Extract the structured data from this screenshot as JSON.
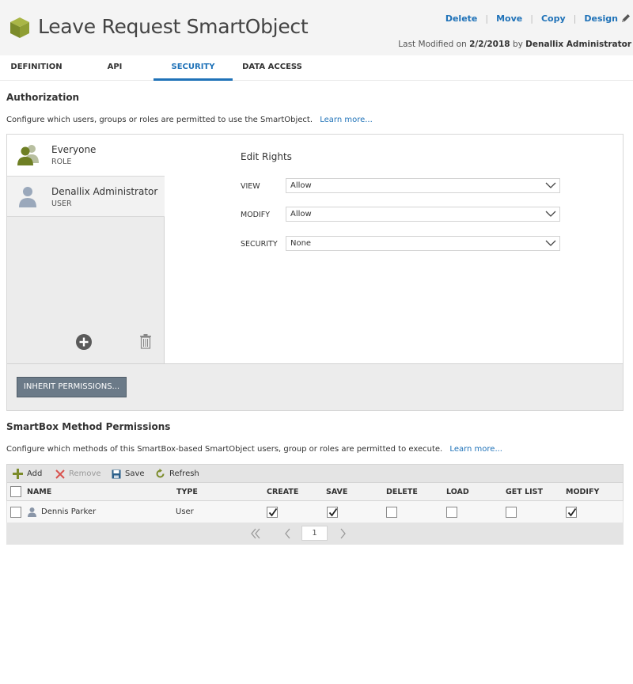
{
  "header": {
    "title": "Leave Request SmartObject",
    "actions": [
      "Delete",
      "Move",
      "Copy",
      "Design"
    ],
    "modified_prefix": "Last Modified on",
    "modified_date": "2/2/2018",
    "modified_by_prefix": "by",
    "modified_by": "Denallix Administrator"
  },
  "tabs": [
    "DEFINITION",
    "API",
    "SECURITY",
    "DATA ACCESS"
  ],
  "active_tab": "SECURITY",
  "authorization": {
    "title": "Authorization",
    "description": "Configure which users, groups or roles are permitted to use the SmartObject.",
    "learn_more": "Learn more...",
    "items": [
      {
        "name": "Everyone",
        "type": "ROLE"
      },
      {
        "name": "Denallix Administrator",
        "type": "USER"
      }
    ],
    "edit_rights_title": "Edit Rights",
    "rights": [
      {
        "label": "VIEW",
        "value": "Allow"
      },
      {
        "label": "MODIFY",
        "value": "Allow"
      },
      {
        "label": "SECURITY",
        "value": "None"
      }
    ],
    "inherit_button": "INHERIT PERMISSIONS..."
  },
  "smartbox": {
    "title": "SmartBox Method Permissions",
    "description": "Configure which methods of this SmartBox-based SmartObject users, group or roles are permitted to execute.",
    "learn_more": "Learn more...",
    "toolbar": {
      "add": "Add",
      "remove": "Remove",
      "save": "Save",
      "refresh": "Refresh"
    },
    "columns": [
      "NAME",
      "TYPE",
      "CREATE",
      "SAVE",
      "DELETE",
      "LOAD",
      "GET LIST",
      "MODIFY"
    ],
    "rows": [
      {
        "name": "Dennis Parker",
        "type": "User",
        "create": true,
        "save": true,
        "delete": false,
        "load": false,
        "get_list": false,
        "modify": true
      }
    ],
    "page": "1"
  },
  "colors": {
    "accent": "#1f72b8",
    "icon_green": "#7b8b2a",
    "button": "#6b7a88"
  }
}
